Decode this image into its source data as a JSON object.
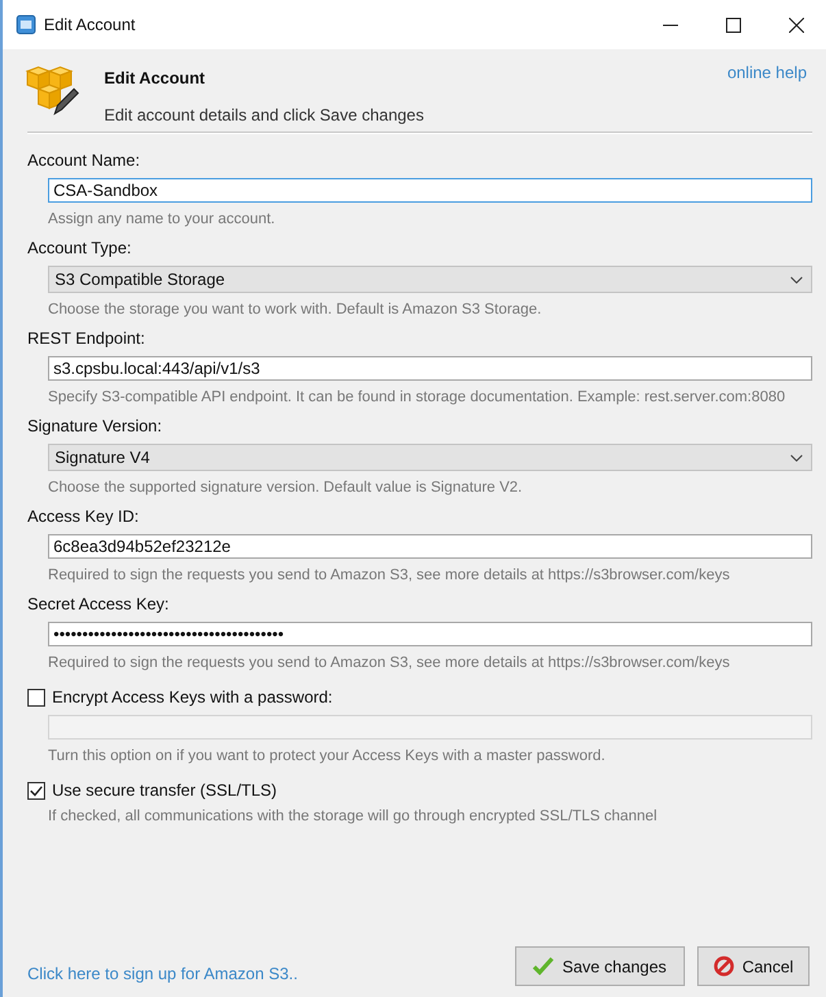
{
  "window": {
    "title": "Edit Account"
  },
  "header": {
    "title": "Edit Account",
    "subtitle": "Edit account details and click Save changes",
    "help_link": "online help"
  },
  "fields": [
    {
      "kind": "text",
      "label": "Account Name:",
      "value": "CSA-Sandbox",
      "hint": "Assign any name to your account.",
      "focused": true
    },
    {
      "kind": "select",
      "label": "Account Type:",
      "value": "S3 Compatible Storage",
      "hint": "Choose the storage you want to work with. Default is Amazon S3 Storage."
    },
    {
      "kind": "text",
      "label": "REST Endpoint:",
      "value": "s3.cpsbu.local:443/api/v1/s3",
      "hint": "Specify S3-compatible API endpoint. It can be found in storage documentation. Example: rest.server.com:8080",
      "focused": false
    },
    {
      "kind": "select",
      "label": "Signature Version:",
      "value": "Signature V4",
      "hint": "Choose the supported signature version.  Default value is Signature V2."
    },
    {
      "kind": "text",
      "label": "Access Key ID:",
      "value": "6c8ea3d94b52ef23212e",
      "hint": "Required to sign the requests you send to Amazon S3, see more details at https://s3browser.com/keys",
      "focused": false
    },
    {
      "kind": "text",
      "label": "Secret Access Key:",
      "value": "••••••••••••••••••••••••••••••••••••••••",
      "hint": "Required to sign the requests you send to Amazon S3, see more details at https://s3browser.com/keys",
      "focused": false
    },
    {
      "kind": "checkbox_field",
      "label": "Encrypt Access Keys with a password:",
      "checked": false,
      "field_disabled": true,
      "hint": "Turn this option on if you want to protect your Access Keys with a master password."
    },
    {
      "kind": "checkbox",
      "label": "Use secure transfer (SSL/TLS)",
      "checked": true,
      "hint": "If checked, all communications with the storage will go through encrypted SSL/TLS channel"
    }
  ],
  "footer": {
    "link": "Click here to sign up for Amazon S3..",
    "buttons": [
      {
        "kind": "save",
        "label": "Save changes"
      },
      {
        "kind": "cancel",
        "label": "Cancel"
      }
    ]
  }
}
